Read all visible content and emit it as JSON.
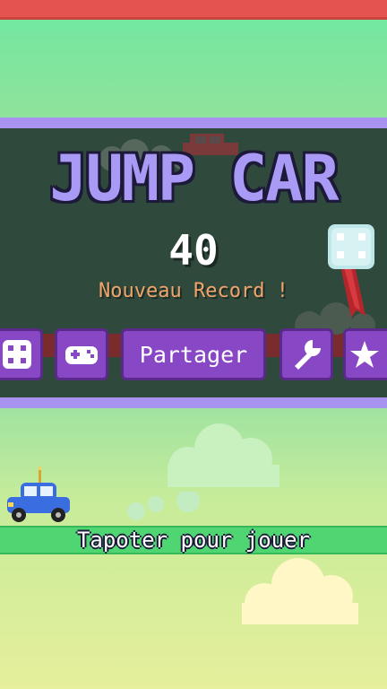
{
  "game": {
    "title": "JUMP CAR",
    "score": "40",
    "record_message": "Nouveau Record !"
  },
  "menu": {
    "share_label": "Partager",
    "buttons": [
      {
        "icon": "dice-icon"
      },
      {
        "icon": "gamepad-icon"
      },
      {
        "icon": "share-button"
      },
      {
        "icon": "wrench-icon"
      },
      {
        "icon": "star-icon"
      }
    ]
  },
  "prompt": {
    "tap_to_play": "Tapoter pour jouer"
  },
  "colors": {
    "top_bar": "#e4534f",
    "panel_border": "#a894f0",
    "panel_bg": "#2f4a3d",
    "title": "#a99af5",
    "record_text": "#f0a36a",
    "button": "#8847c5",
    "tap_bar": "#4fd673",
    "player_car": "#3a6ee0"
  }
}
